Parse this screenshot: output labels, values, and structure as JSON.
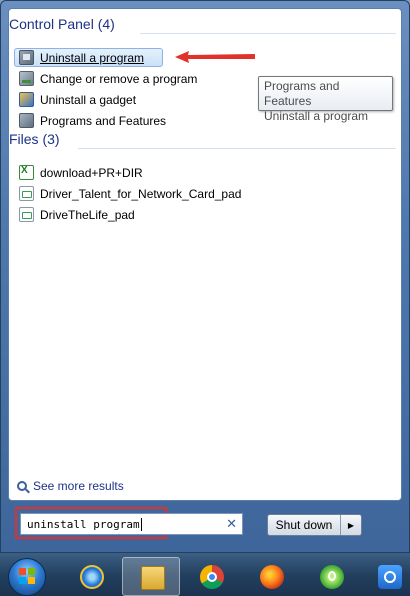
{
  "search_results": {
    "control_panel": {
      "title": "Control Panel (4)",
      "items": [
        {
          "label": "Uninstall a program",
          "icon": "uninstall-program-icon",
          "selected": true
        },
        {
          "label": "Change or remove a program",
          "icon": "change-program-icon"
        },
        {
          "label": "Uninstall a gadget",
          "icon": "gadget-icon"
        },
        {
          "label": "Programs and Features",
          "icon": "programs-features-icon"
        }
      ]
    },
    "files": {
      "title": "Files (3)",
      "items": [
        {
          "label": "download+PR+DIR",
          "icon": "excel-file-icon"
        },
        {
          "label": "Driver_Talent_for_Network_Card_pad",
          "icon": "document-file-icon"
        },
        {
          "label": "DriveTheLife_pad",
          "icon": "document-file-icon"
        }
      ]
    },
    "tooltip": {
      "line1": "Programs and Features",
      "line2": "Uninstall a program"
    },
    "see_more": "See more results"
  },
  "search_box": {
    "value": "uninstall program",
    "clear_icon": "close-icon"
  },
  "shutdown": {
    "label": "Shut down",
    "options_icon": "triangle-right-icon"
  },
  "taskbar": {
    "start": "windows-start-orb-icon",
    "apps": [
      "internet-explorer-icon",
      "file-explorer-icon",
      "chrome-icon",
      "firefox-icon",
      "green-refresh-app-icon",
      "blue-app-icon"
    ],
    "active_app": "file-explorer-icon"
  },
  "colors": {
    "group_title": "#1e3287",
    "highlight_border": "#e0322a",
    "arrow": "#e0322a"
  }
}
